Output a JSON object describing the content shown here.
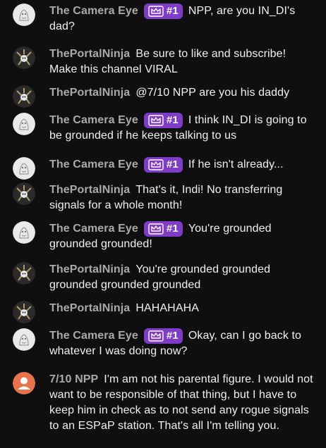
{
  "messages": [
    {
      "author": "The Camera Eye",
      "avatar": "camera-eye-avatar",
      "badge": "#1",
      "text": "NPP, are you IN_DI's dad?"
    },
    {
      "author": "ThePortalNinja",
      "avatar": "portal-ninja-avatar",
      "badge": null,
      "text": "Be sure to like and subscribe! Make this channel VIRAL"
    },
    {
      "author": "ThePortalNinja",
      "avatar": "portal-ninja-avatar",
      "badge": null,
      "text": "@7/10 NPP are you his daddy"
    },
    {
      "author": "The Camera Eye",
      "avatar": "camera-eye-avatar",
      "badge": "#1",
      "text": "I think IN_DI is going to be grounded if he keeps talking to us"
    },
    {
      "author": "The Camera Eye",
      "avatar": "camera-eye-avatar",
      "badge": "#1",
      "text": "If he isn't already..."
    },
    {
      "author": "ThePortalNinja",
      "avatar": "portal-ninja-avatar",
      "badge": null,
      "text": "That's it, Indi! No transferring signals for a whole month!"
    },
    {
      "author": "The Camera Eye",
      "avatar": "camera-eye-avatar",
      "badge": "#1",
      "text": "You're grounded grounded grounded!"
    },
    {
      "author": "ThePortalNinja",
      "avatar": "portal-ninja-avatar",
      "badge": null,
      "text": "You're grounded grounded grounded grounded grounded"
    },
    {
      "author": "ThePortalNinja",
      "avatar": "portal-ninja-avatar",
      "badge": null,
      "text": "HAHAHAHA"
    },
    {
      "author": "The Camera Eye",
      "avatar": "camera-eye-avatar",
      "badge": "#1",
      "text": "Okay, can I go back to whatever I was doing now?"
    },
    {
      "author": "7/10 NPP",
      "avatar": "default-user-avatar",
      "badge": null,
      "text": "I'm am not his parental figure. I would not want to be responsible of that thing, but I have to keep him in check as to not send any rogue signals to an ESPaP station. That's all I'm telling you."
    }
  ],
  "colors": {
    "background": "#0f0f0f",
    "author": "#aaaaaa",
    "text": "#f1f1f1",
    "badge": "#7f3cc8",
    "default_avatar": "#e8734a"
  },
  "icons": {
    "badge_icon": "crown-icon"
  }
}
